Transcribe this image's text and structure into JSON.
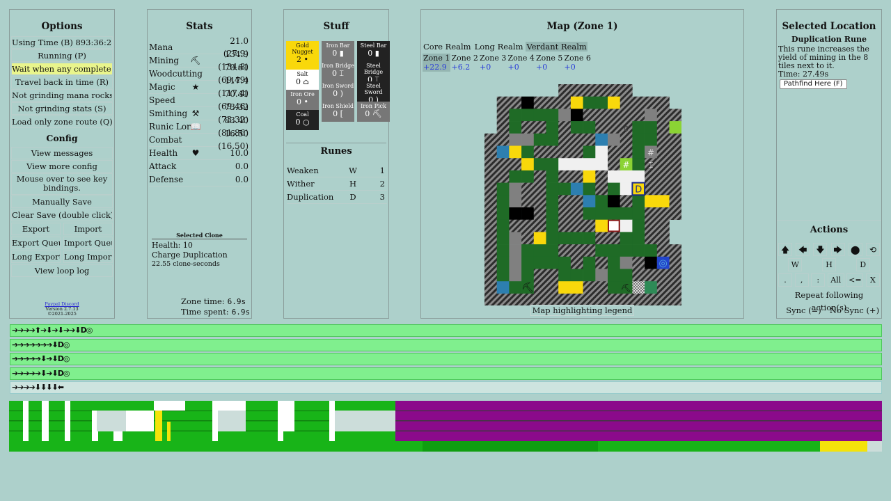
{
  "options": {
    "title": "Options",
    "items": [
      "Using Time (B) 893:36:28",
      "Running (P)",
      "Wait when any complete (W)",
      "Travel back in time (R)",
      "Not grinding mana rocks (G)",
      "Not grinding stats (S)",
      "Load only zone route (Q)"
    ],
    "config_title": "Config",
    "config_items": [
      "View messages",
      "View more config",
      "Mouse over to see key bindings.",
      "Manually Save",
      "Clear Save (double click)"
    ],
    "export": "Export",
    "import": "Import",
    "export_queue": "Export Queue",
    "import_queue": "Import Queue",
    "long_export": "Long Export",
    "long_import": "Long Import",
    "view_loop_log": "View loop log",
    "discord": "Paypal Discord",
    "version": "Version 2.7.13",
    "copyright": "©2021-2025"
  },
  "stats": {
    "title": "Stats",
    "rows": [
      {
        "name": "Mana",
        "icon": "",
        "value": "21.0 (27.9)"
      },
      {
        "name": "Mining",
        "icon": "⛏",
        "value": "134.9 (134.8)"
      },
      {
        "name": "Woodcutting",
        "icon": "",
        "value": "70.61 (69.49)"
      },
      {
        "name": "Magic",
        "icon": "★",
        "value": "117.4 (117.4)"
      },
      {
        "name": "Speed",
        "icon": "",
        "value": "70.41 (69.46)"
      },
      {
        "name": "Smithing",
        "icon": "⚒",
        "value": "73.32 (73.32)"
      },
      {
        "name": "Runic Lore",
        "icon": "📖",
        "value": "83.40 (81.86)"
      },
      {
        "name": "Combat",
        "icon": "",
        "value": "16.50 (16.50)"
      },
      {
        "name": "Health",
        "icon": "♥",
        "value": "10.0"
      },
      {
        "name": "Attack",
        "icon": "",
        "value": "0.0"
      },
      {
        "name": "Defense",
        "icon": "",
        "value": "0.0"
      }
    ],
    "selected_clone_title": "Selected Clone",
    "clone_health": "Health: 10",
    "clone_charge": "Charge Duplication",
    "clone_seconds": "22.55 clone-seconds",
    "zone_time_label": "Zone time:",
    "zone_time": "6.9s",
    "time_spent_label": "Time spent:",
    "time_spent": "6.9s"
  },
  "stuff": {
    "title": "Stuff",
    "col1": [
      {
        "name": "Gold Nugget",
        "count": "2 •",
        "style": "gold"
      },
      {
        "name": "Salt",
        "count": "0 ⌂",
        "style": "salt"
      },
      {
        "name": "Iron Ore",
        "count": "0 •",
        "style": "grey"
      },
      {
        "name": "Coal",
        "count": "0 ○",
        "style": "dark"
      }
    ],
    "col2": [
      {
        "name": "Iron Bar",
        "count": "0 ▮",
        "style": "grey"
      },
      {
        "name": "Iron Bridge",
        "count": "0 ⌶",
        "style": "grey"
      },
      {
        "name": "Iron Sword",
        "count": "0 )",
        "style": "grey"
      },
      {
        "name": "Iron Shield",
        "count": "0 [",
        "style": "grey"
      }
    ],
    "col3": [
      {
        "name": "Steel Bar",
        "count": "0 ▮",
        "style": "dark"
      },
      {
        "name": "Steel Bridge",
        "count": "0 ⌶",
        "style": "dark"
      },
      {
        "name": "Steel Sword",
        "count": "0 )",
        "style": "dark"
      },
      {
        "name": "Iron Pick",
        "count": "0 ⛏",
        "style": "grey"
      }
    ],
    "runes_title": "Runes",
    "runes": [
      {
        "name": "Weaken",
        "key": "W",
        "count": "1"
      },
      {
        "name": "Wither",
        "key": "H",
        "count": "2"
      },
      {
        "name": "Duplication",
        "key": "D",
        "count": "3"
      }
    ]
  },
  "map": {
    "title": "Map (Zone 1)",
    "realms": [
      "Core Realm",
      "Long Realm",
      "Verdant Realm"
    ],
    "zones": [
      {
        "name": "Zone 1",
        "gain": "+22.9"
      },
      {
        "name": "Zone 2",
        "gain": "+6.2"
      },
      {
        "name": "Zone 3",
        "gain": "+0"
      },
      {
        "name": "Zone 4",
        "gain": "+0"
      },
      {
        "name": "Zone 5",
        "gain": "+0"
      },
      {
        "name": "Zone 6",
        "gain": "+0"
      }
    ],
    "legend": "Map highlighting legend",
    "glyphs": {
      "pick": "⛏",
      "hash": "#",
      "bridge": "⌶",
      "rune_d": "D",
      "coal": "¢",
      "clone": "◎"
    },
    "colors": {
      "wall": "#3a3a3a",
      "path": "#1f6b26",
      "gold": "#f9d80b",
      "water": "#2d7fb0",
      "grass": "#8bd334",
      "salt": "#f0f0f0",
      "stone": "#808080",
      "void": "#000000"
    }
  },
  "selected": {
    "title": "Selected Location",
    "name": "Duplication Rune",
    "desc": "This rune increases the yield of mining in the 8 tiles next to it.",
    "time": "Time: 27.49s",
    "pathfind": "Pathfind Here (F)"
  },
  "actions": {
    "title": "Actions",
    "arrows": [
      "🡅",
      "🡄",
      "🡇",
      "🡆",
      "⬤",
      "⟲"
    ],
    "runes": [
      "W",
      "H",
      "D"
    ],
    "misc": [
      ".",
      ",",
      ":",
      "All",
      "<=",
      "X"
    ],
    "repeat": "Repeat following action(s)",
    "sync": "Sync (=)",
    "nosync": "No Sync (+)"
  },
  "queues": [
    {
      "text": "➔➔➔➔⬆➔⬇➔⬇➔➔⬇D",
      "end": "◎"
    },
    {
      "text": "➔➔➔➔➔➔➔⬇D",
      "end": "◎"
    },
    {
      "text": "➔➔➔➔➔⬇➔⬇D",
      "end": "◎"
    },
    {
      "text": "➔➔➔➔➔⬇➔⬇D",
      "end": "◎"
    },
    {
      "text": "➔➔➔➔⬇⬇⬇⬇⬅",
      "end": ""
    }
  ]
}
